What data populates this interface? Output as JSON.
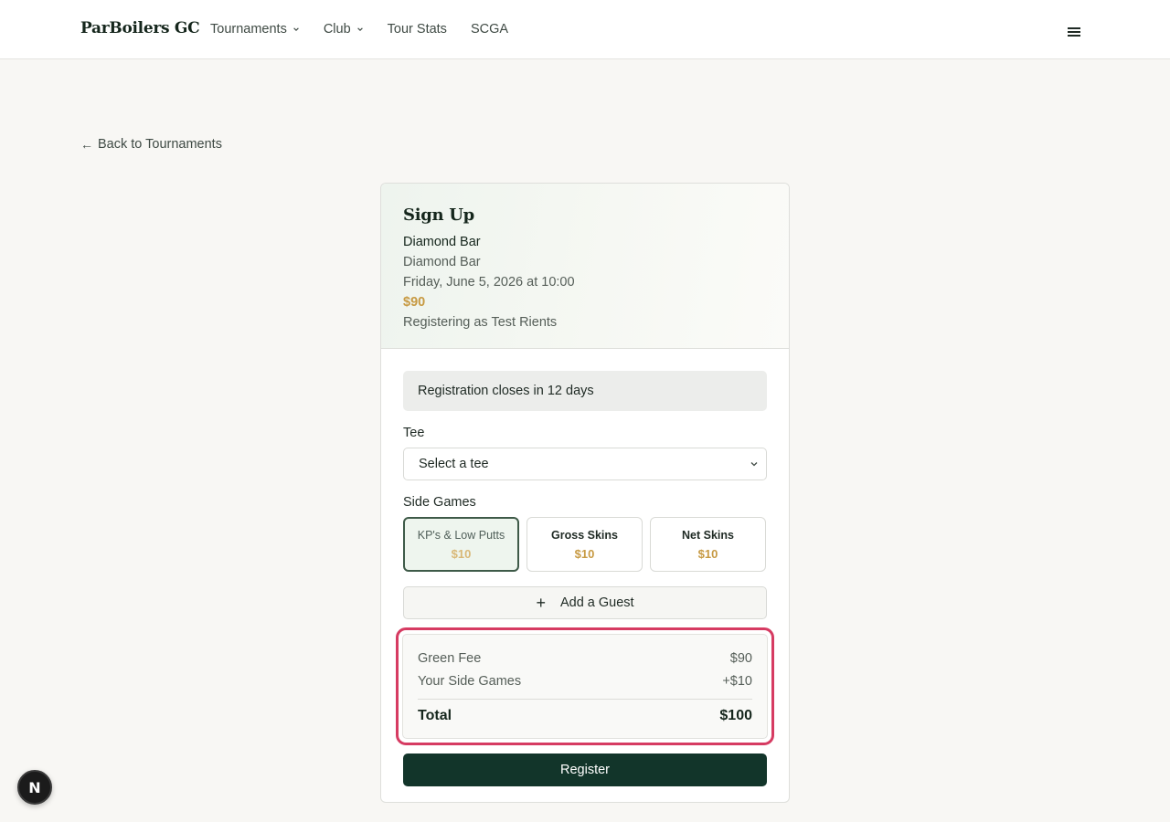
{
  "header": {
    "brand": "ParBoilers GC",
    "nav": [
      {
        "label": "Tournaments",
        "has_dropdown": true
      },
      {
        "label": "Club",
        "has_dropdown": true
      },
      {
        "label": "Tour Stats",
        "has_dropdown": false
      },
      {
        "label": "SCGA",
        "has_dropdown": false
      }
    ],
    "menu_icon": "hamburger-icon"
  },
  "back_link": {
    "arrow": "←",
    "label": "Back to Tournaments"
  },
  "signup": {
    "title": "Sign Up",
    "event_name": "Diamond Bar",
    "course": "Diamond Bar",
    "datetime": "Friday, June 5, 2026 at 10:00",
    "price": "$90",
    "registering_as": "Registering as Test Rients",
    "notice": "Registration closes in 12 days",
    "tee": {
      "label": "Tee",
      "selected": "Select a tee"
    },
    "side_games": {
      "label": "Side Games",
      "items": [
        {
          "name": "KP's & Low Putts",
          "price": "$10",
          "selected": true
        },
        {
          "name": "Gross Skins",
          "price": "$10",
          "selected": false
        },
        {
          "name": "Net Skins",
          "price": "$10",
          "selected": false
        }
      ]
    },
    "add_guest": {
      "icon": "+",
      "label": "Add a Guest"
    },
    "summary": {
      "green_fee_label": "Green Fee",
      "green_fee_value": "$90",
      "side_games_label": "Your Side Games",
      "side_games_value": "+$10",
      "total_label": "Total",
      "total_value": "$100"
    },
    "register_label": "Register"
  },
  "dev_badge": {
    "letter": "N"
  },
  "colors": {
    "accent_dark_green": "#12352a",
    "price_gold": "#c79a43",
    "highlight_pink": "#d63b62"
  }
}
